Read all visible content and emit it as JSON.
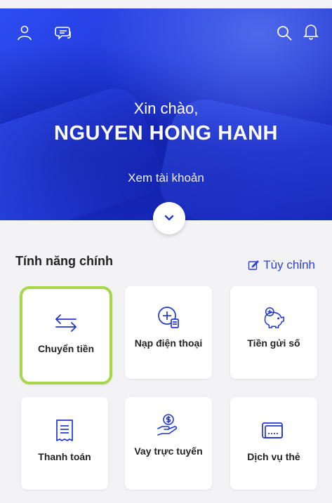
{
  "header": {
    "greeting": "Xin chào,",
    "user_name": "NGUYEN HONG HANH",
    "view_account": "Xem tài khoản",
    "icons": [
      "user-icon",
      "chat-icon",
      "search-icon",
      "bell-icon"
    ]
  },
  "features": {
    "title": "Tính năng chính",
    "customize_label": "Tùy chỉnh",
    "items": [
      {
        "label": "Chuyển tiền",
        "icon": "transfer-icon",
        "selected": true
      },
      {
        "label": "Nạp điện thoại",
        "icon": "phone-topup-icon",
        "selected": false
      },
      {
        "label": "Tiền gửi số",
        "icon": "piggy-bank-icon",
        "selected": false
      },
      {
        "label": "Thanh toán",
        "icon": "bill-icon",
        "selected": false
      },
      {
        "label": "Vay trực tuyến",
        "icon": "loan-icon",
        "selected": false
      },
      {
        "label": "Dịch vụ thẻ",
        "icon": "card-icon",
        "selected": false
      }
    ]
  },
  "colors": {
    "brand_blue": "#2035d6",
    "accent_link": "#2a3fd8",
    "selection_green": "#a7d64a",
    "background": "#f3f3f5"
  }
}
